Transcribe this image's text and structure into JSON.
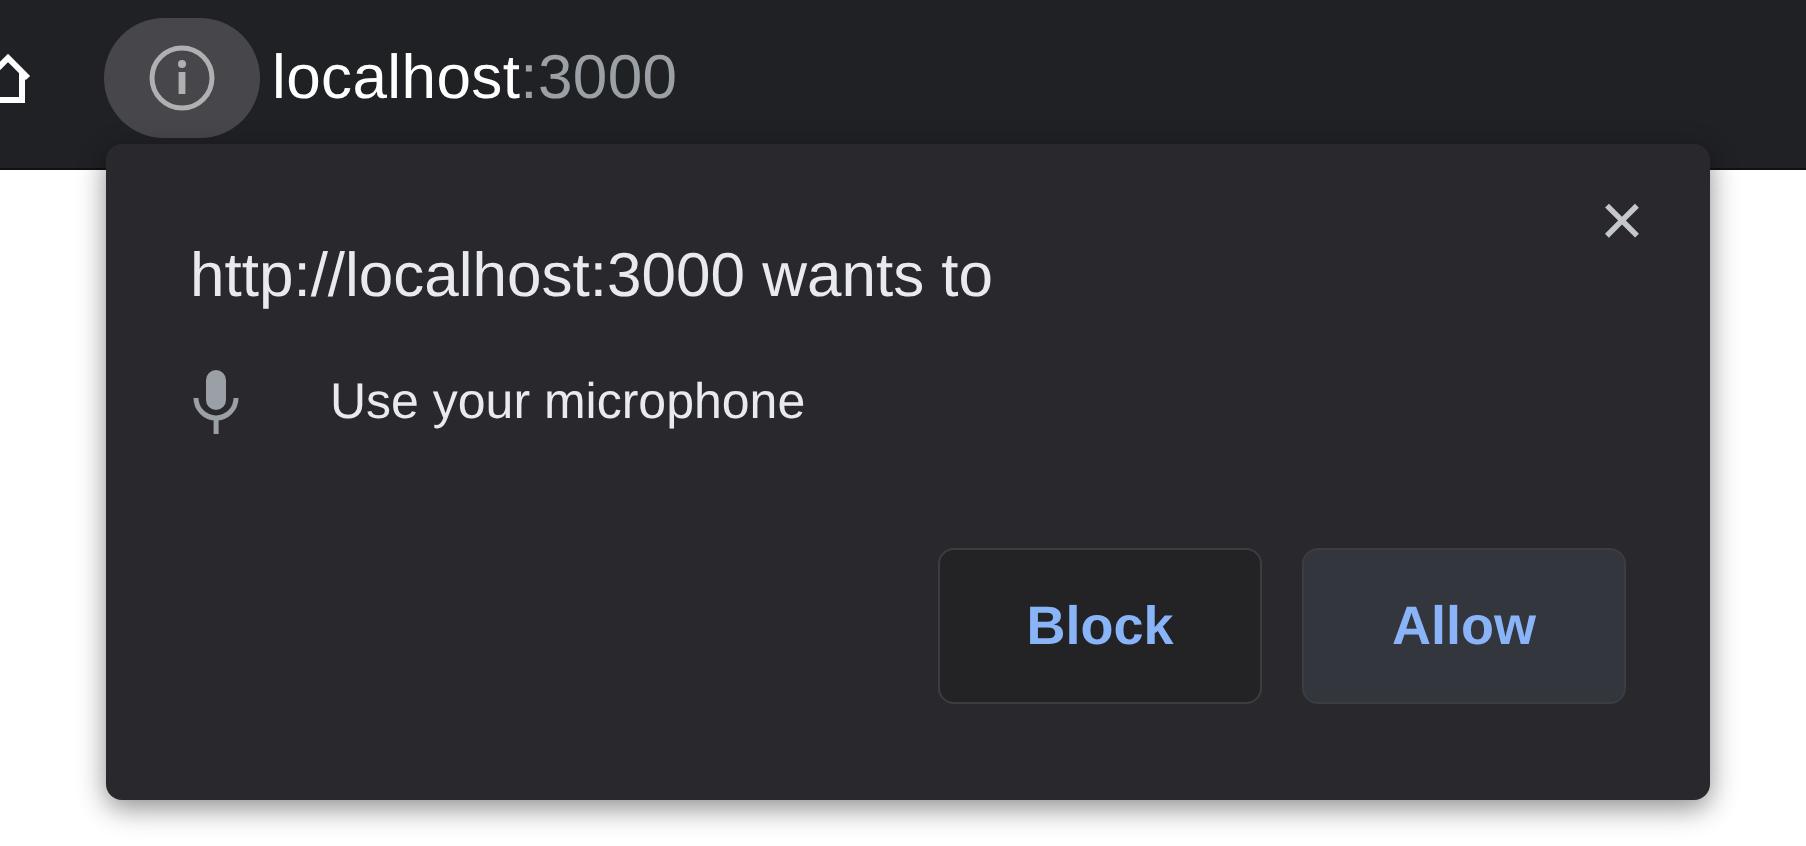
{
  "address_bar": {
    "host": "localhost",
    "port": ":3000"
  },
  "permission_popup": {
    "title": "http://localhost:3000 wants to",
    "permissions": [
      {
        "kind": "microphone",
        "label": "Use your microphone"
      }
    ],
    "close": "×",
    "buttons": [
      {
        "label": "Block",
        "kind": "secondary"
      },
      {
        "label": "Allow",
        "kind": "primary"
      }
    ]
  }
}
